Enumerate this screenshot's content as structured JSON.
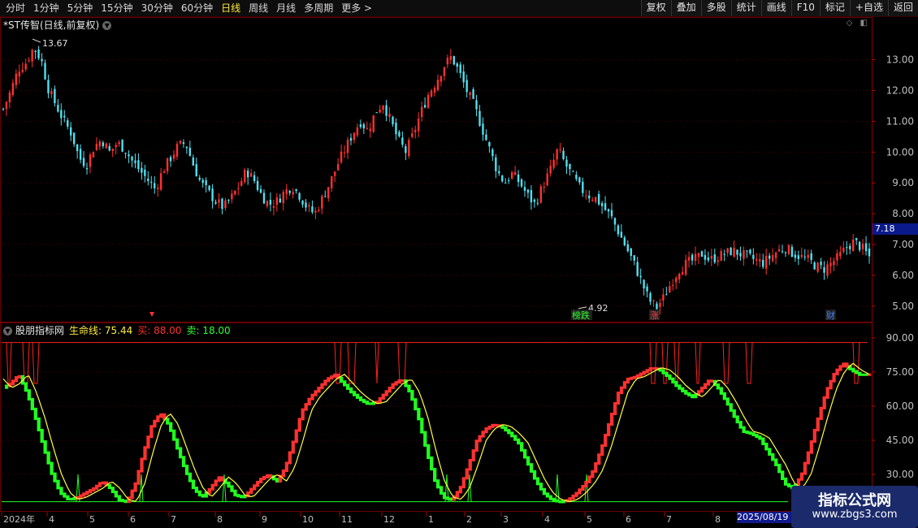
{
  "toolbar": {
    "periods": [
      {
        "label": "分时",
        "active": false
      },
      {
        "label": "1分钟",
        "active": false
      },
      {
        "label": "5分钟",
        "active": false
      },
      {
        "label": "15分钟",
        "active": false
      },
      {
        "label": "30分钟",
        "active": false
      },
      {
        "label": "60分钟",
        "active": false
      },
      {
        "label": "日线",
        "active": true
      },
      {
        "label": "周线",
        "active": false
      },
      {
        "label": "月线",
        "active": false
      },
      {
        "label": "多周期",
        "active": false
      },
      {
        "label": "更多 >",
        "active": false
      }
    ],
    "buttons": [
      "复权",
      "叠加",
      "多股",
      "统计",
      "画线",
      "F10",
      "标记",
      "+自选",
      "返回"
    ]
  },
  "stock_title": "*ST传智(日线,前复权)",
  "price_axis": [
    "13.00",
    "12.00",
    "11.00",
    "10.00",
    "9.00",
    "8.00",
    "7.00",
    "6.00",
    "5.00"
  ],
  "current_price": "7.18",
  "high_marker": "13.67",
  "low_marker": "4.92",
  "events": [
    {
      "text": "榜跌",
      "color": "#30ff30"
    },
    {
      "text": "涨",
      "color": "#ff4040"
    },
    {
      "text": "财",
      "color": "#4080ff"
    }
  ],
  "indicator": {
    "name": "股朋指标网",
    "life_line": "生命线: 75.44",
    "buy": "买: 88.00",
    "sell": "卖: 18.00"
  },
  "ind_axis": [
    "90.00",
    "75.00",
    "60.00",
    "45.00",
    "30.00"
  ],
  "x_axis": [
    "2024年",
    "4",
    "5",
    "6",
    "7",
    "8",
    "9",
    "10",
    "11",
    "12",
    "1",
    "2",
    "3",
    "4",
    "5",
    "6",
    "7",
    "8"
  ],
  "date_flag": "2025/08/19",
  "watermark": {
    "main": "指标公式网",
    "url": "www.zbgs3.com"
  },
  "colors": {
    "up": "#ff3030",
    "down": "#50e0f0",
    "life": "#ffff40",
    "buy_line": "#ff2020",
    "sell_line": "#20ff20",
    "grid": "#4a0000"
  },
  "chart_data": [
    {
      "type": "candlestick",
      "title": "*ST传智(日线,前复权)",
      "ylim": [
        4.6,
        14.2
      ],
      "close_path": [
        11.4,
        12.0,
        12.7,
        12.9,
        13.4,
        13.0,
        12.0,
        11.5,
        11.0,
        10.6,
        9.8,
        9.6,
        10.2,
        10.4,
        10.0,
        10.3,
        10.1,
        9.7,
        9.4,
        9.1,
        8.8,
        9.4,
        9.8,
        10.2,
        10.3,
        9.6,
        9.0,
        8.7,
        8.4,
        8.2,
        8.5,
        8.9,
        9.4,
        9.1,
        8.6,
        8.3,
        8.4,
        8.7,
        8.9,
        8.6,
        8.2,
        8.0,
        8.5,
        9.0,
        9.6,
        10.1,
        10.6,
        11.0,
        10.7,
        11.3,
        11.6,
        11.0,
        10.4,
        10.0,
        10.6,
        11.3,
        11.9,
        12.3,
        12.8,
        13.1,
        12.6,
        12.0,
        11.5,
        10.8,
        10.1,
        9.4,
        9.0,
        9.3,
        9.0,
        8.6,
        8.3,
        8.9,
        9.4,
        10.1,
        9.6,
        9.2,
        8.8,
        8.6,
        8.5,
        8.2,
        7.9,
        7.4,
        6.9,
        6.4,
        5.8,
        5.2,
        4.95,
        5.3,
        5.8,
        6.2,
        6.4,
        6.5,
        6.7,
        6.5,
        6.6,
        6.7,
        6.8,
        6.7,
        6.6,
        6.5,
        6.4,
        6.6,
        6.8,
        6.9,
        6.7,
        6.6,
        6.5,
        6.3,
        6.2,
        6.4,
        6.6,
        6.9,
        7.1,
        6.9,
        6.6
      ],
      "visible_bars": 270
    },
    {
      "type": "line",
      "title": "股朋指标网",
      "ylim": [
        15,
        95
      ],
      "series": [
        {
          "name": "生命线",
          "values": [
            72,
            68,
            70,
            74,
            66,
            55,
            42,
            30,
            22,
            19,
            20,
            22,
            24,
            27,
            24,
            19,
            18,
            26,
            40,
            52,
            57,
            52,
            42,
            32,
            24,
            20,
            24,
            29,
            26,
            21,
            20,
            24,
            28,
            30,
            27,
            33,
            45,
            58,
            64,
            68,
            72,
            74,
            70,
            66,
            63,
            61,
            62,
            66,
            70,
            72,
            66,
            55,
            40,
            27,
            20,
            19,
            24,
            34,
            45,
            50,
            52,
            51,
            48,
            44,
            36,
            28,
            22,
            19,
            18,
            19,
            22,
            26,
            32,
            42,
            54,
            66,
            72,
            73,
            75,
            77,
            76,
            73,
            69,
            66,
            64,
            68,
            72,
            68,
            62,
            55,
            49,
            48,
            46,
            40,
            34,
            26,
            24,
            30,
            42,
            55,
            67,
            75,
            79,
            76,
            74
          ]
        },
        {
          "name": "买",
          "values": [
            88
          ]
        },
        {
          "name": "卖",
          "values": [
            18
          ]
        }
      ]
    }
  ]
}
